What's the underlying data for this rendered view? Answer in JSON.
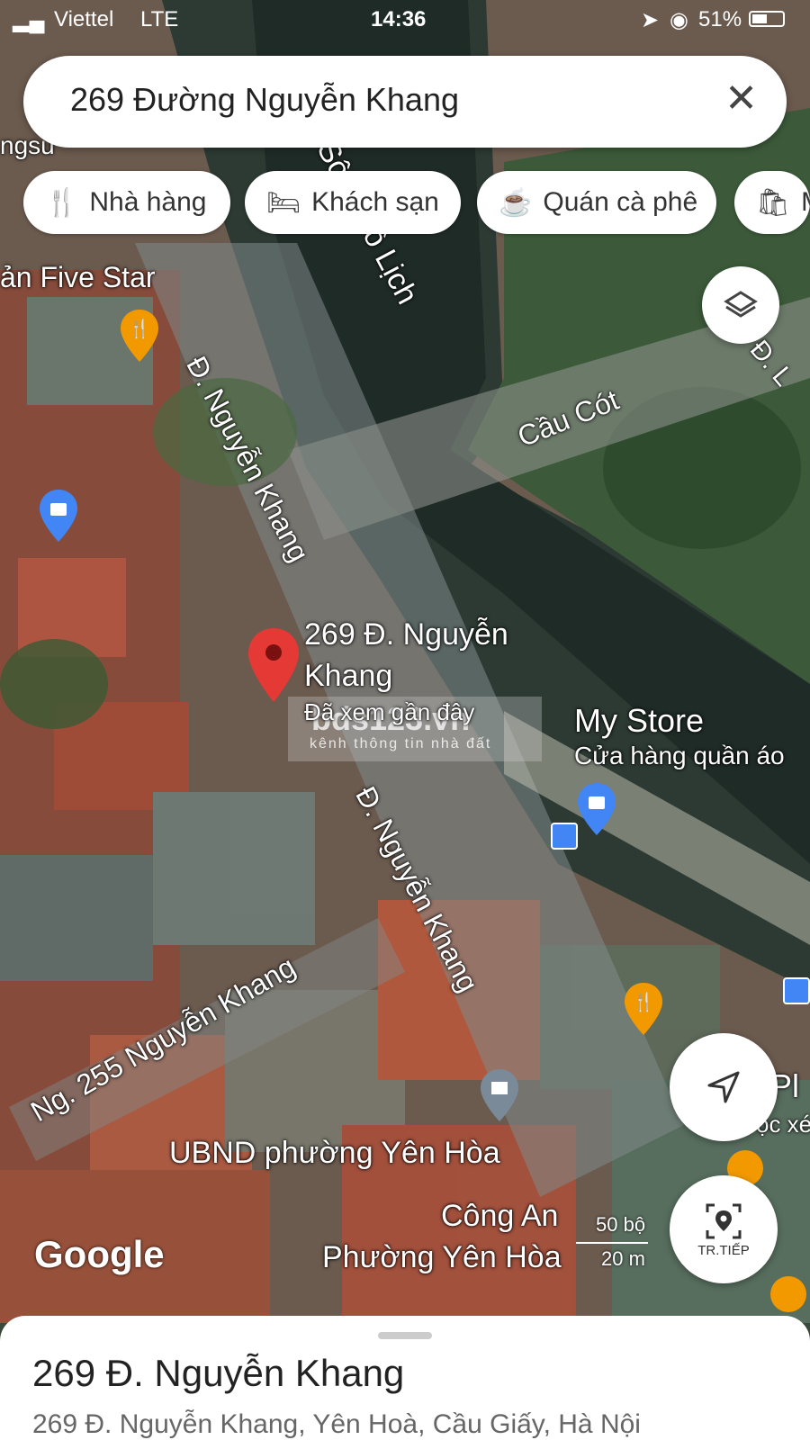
{
  "status_bar": {
    "carrier": "Viettel",
    "network": "LTE",
    "time": "14:36",
    "battery": "51%"
  },
  "search": {
    "query": "269 Đường Nguyễn Khang",
    "clear_icon": "close-icon"
  },
  "chips": [
    {
      "label": "Nhà hàng",
      "icon": "restaurant-icon"
    },
    {
      "label": "Khách sạn",
      "icon": "hotel-icon"
    },
    {
      "label": "Quán cà phê",
      "icon": "coffee-icon"
    },
    {
      "label": "M",
      "icon": "shopping-icon"
    }
  ],
  "map_labels": {
    "five_star": "ản Five Star",
    "river": "Sông Tô Lịch",
    "cau_cot": "Cầu Cót",
    "road_1": "Đ. Nguyễn Khang",
    "road_2": "Đ. Nguyễn Khang",
    "alley": "Ng. 255 Nguyễn Khang",
    "pin_title_line1": "269 Đ. Nguyễn",
    "pin_title_line2": "Khang",
    "pin_sub": "Đã xem gần đây",
    "store_name": "My Store",
    "store_type": "Cửa hàng quần áo",
    "ubnd": "UBND phường Yên Hòa",
    "police_line1": "Công An",
    "police_line2": "Phường Yên Hòa",
    "edge_top_left": "ngsu",
    "edge_right_1": "Đ. L",
    "edge_right_2": "Pl",
    "edge_right_3": "ọc xé",
    "watermark_1": "bds123.vn",
    "watermark_2": "kênh thông tin nhà đất"
  },
  "scale": {
    "top": "50 bộ",
    "bottom": "20 m"
  },
  "controls": {
    "layers_icon": "layers-icon",
    "locate_icon": "navigation-arrow-icon",
    "nearby_label": "TR.TIẾP"
  },
  "brand": "Google",
  "sheet": {
    "title": "269 Đ. Nguyễn Khang",
    "address": "269 Đ. Nguyễn Khang, Yên Hoà, Cầu Giấy, Hà Nội"
  },
  "colors": {
    "pin": "#e53935",
    "poi_blue": "#4285f4",
    "poi_orange": "#f29900",
    "civic": "#7b8a99"
  }
}
